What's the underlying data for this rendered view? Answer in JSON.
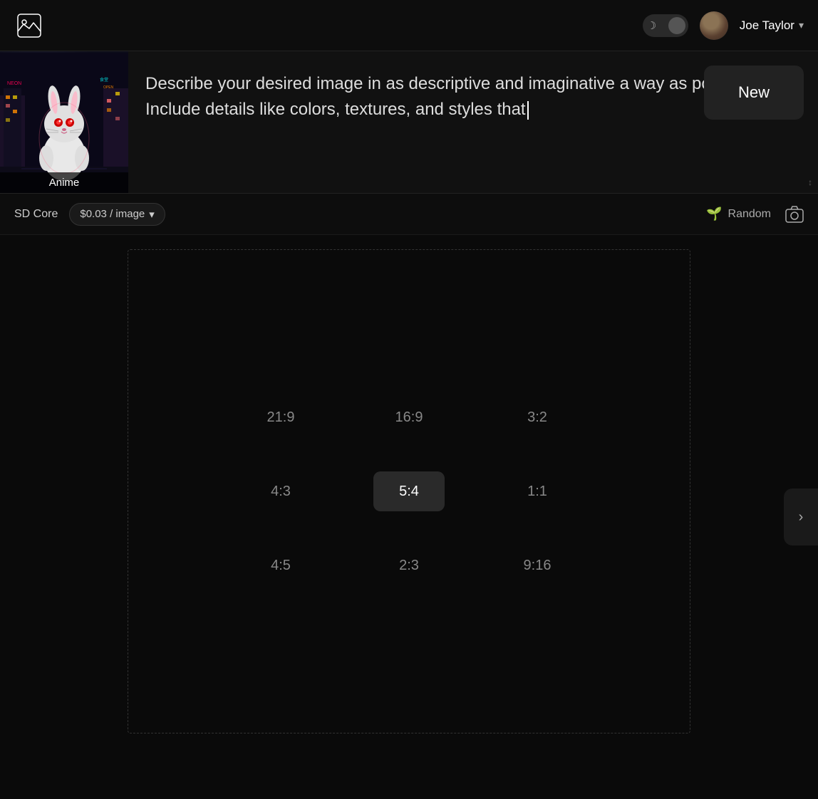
{
  "header": {
    "logo_alt": "image-app-logo",
    "dark_mode_label": "dark mode toggle",
    "user": {
      "name": "Joe Taylor",
      "avatar_alt": "user avatar"
    },
    "chevron": "▾"
  },
  "prompt": {
    "text": "Describe your desired image in as descriptive and imaginative a way as possible. Include details like colors, textures, and styles that",
    "style_label": "Anime",
    "new_button_label": "New"
  },
  "toolbar": {
    "model_name": "SD Core",
    "price": "$0.03 / image",
    "random_label": "Random",
    "dropdown_arrow": "▾"
  },
  "aspect_ratios": {
    "options": [
      {
        "label": "21:9",
        "selected": false
      },
      {
        "label": "16:9",
        "selected": false
      },
      {
        "label": "3:2",
        "selected": false
      },
      {
        "label": "4:3",
        "selected": false
      },
      {
        "label": "5:4",
        "selected": true
      },
      {
        "label": "1:1",
        "selected": false
      },
      {
        "label": "4:5",
        "selected": false
      },
      {
        "label": "2:3",
        "selected": false
      },
      {
        "label": "9:16",
        "selected": false
      }
    ]
  },
  "sidebar": {
    "arrow_label": "›"
  }
}
